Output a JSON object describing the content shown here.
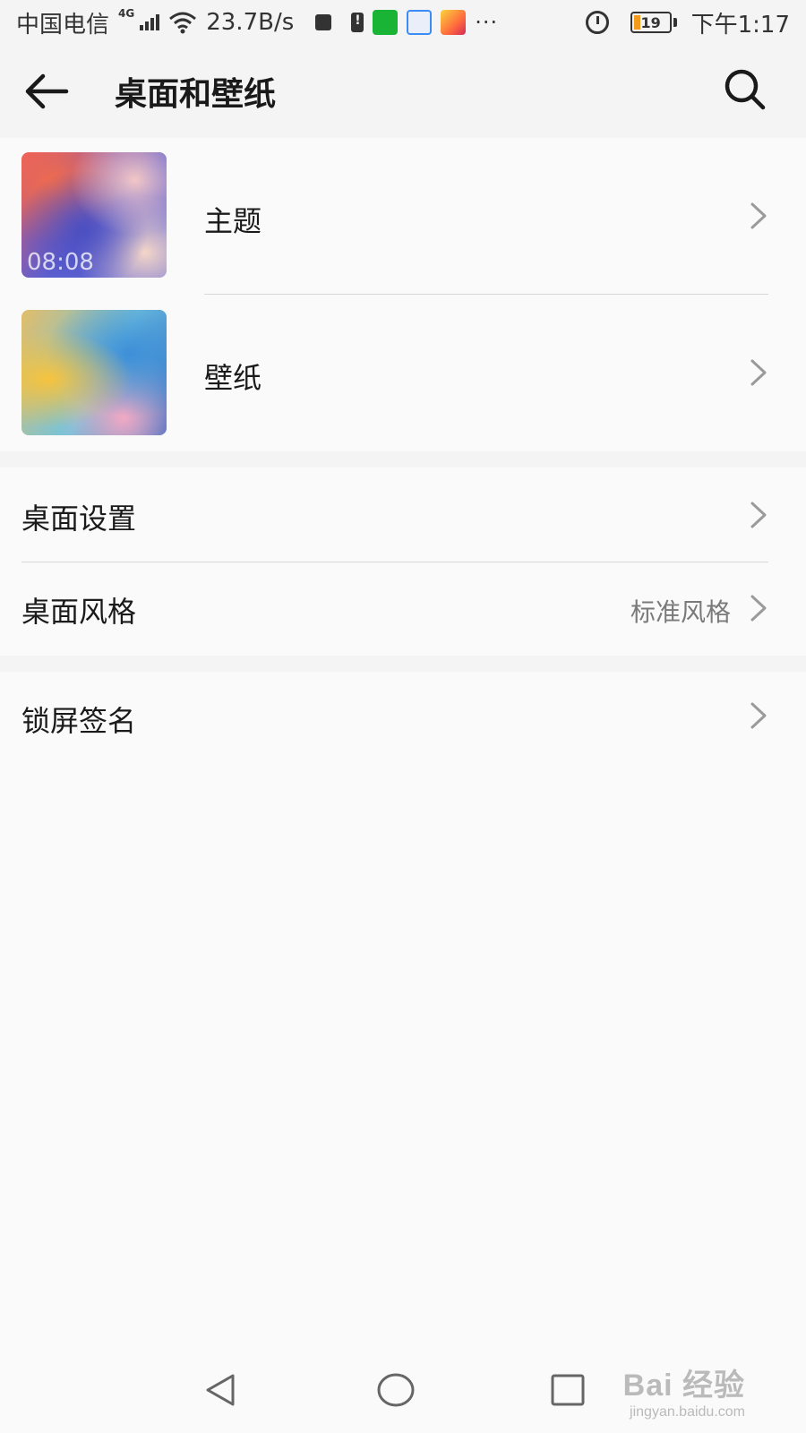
{
  "status_bar": {
    "carrier": "中国电信",
    "network_type": "4G",
    "speed": "23.7B/s",
    "battery_level": "19",
    "battery_fraction": 0.19,
    "time": "下午1:17",
    "more": "···"
  },
  "header": {
    "title": "桌面和壁纸"
  },
  "sections": {
    "themes": {
      "theme": {
        "label": "主题",
        "thumb_time": "08:08"
      },
      "wallpaper": {
        "label": "壁纸"
      }
    },
    "desktop": {
      "settings": {
        "label": "桌面设置"
      },
      "style": {
        "label": "桌面风格",
        "value": "标准风格"
      }
    },
    "lock": {
      "signature": {
        "label": "锁屏签名"
      }
    }
  },
  "watermark": {
    "logo": "Bai 经验",
    "url": "jingyan.baidu.com"
  },
  "colors": {
    "background": "#f4f4f4",
    "card": "#fafafa",
    "text": "#1a1a1a",
    "secondary_text": "#7a7a7a",
    "divider": "#d8d8d8",
    "battery_fill": "#f29b1c"
  }
}
